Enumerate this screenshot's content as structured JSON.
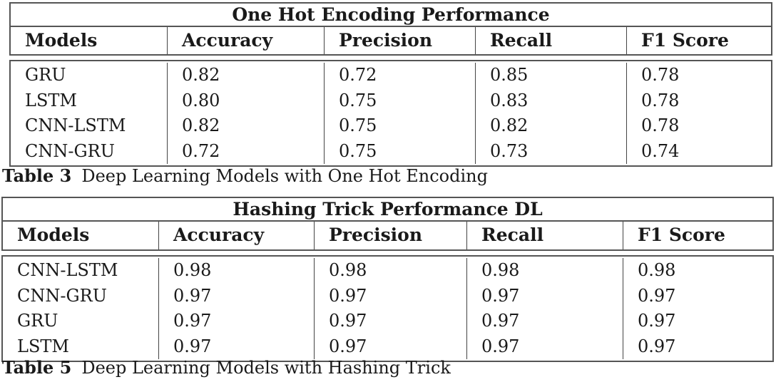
{
  "tables": [
    {
      "title": "One Hot Encoding Performance",
      "columns": [
        "Models",
        "Accuracy",
        "Precision",
        "Recall",
        "F1 Score"
      ],
      "rows": [
        [
          "GRU",
          "0.82",
          "0.72",
          "0.85",
          "0.78"
        ],
        [
          "LSTM",
          "0.80",
          "0.75",
          "0.83",
          "0.78"
        ],
        [
          "CNN-LSTM",
          "0.82",
          "0.75",
          "0.82",
          "0.78"
        ],
        [
          "CNN-GRU",
          "0.72",
          "0.75",
          "0.73",
          "0.74"
        ]
      ],
      "caption_label": "Table 3",
      "caption_text": "Deep Learning Models with One Hot Encoding"
    },
    {
      "title": "Hashing Trick Performance DL",
      "columns": [
        "Models",
        "Accuracy",
        "Precision",
        "Recall",
        "F1 Score"
      ],
      "rows": [
        [
          "CNN-LSTM",
          "0.98",
          "0.98",
          "0.98",
          "0.98"
        ],
        [
          "CNN-GRU",
          "0.97",
          "0.97",
          "0.97",
          "0.97"
        ],
        [
          "GRU",
          "0.97",
          "0.97",
          "0.97",
          "0.97"
        ],
        [
          "LSTM",
          "0.97",
          "0.97",
          "0.97",
          "0.97"
        ]
      ],
      "caption_label": "Table 5",
      "caption_text": "Deep Learning Models with Hashing Trick"
    }
  ]
}
